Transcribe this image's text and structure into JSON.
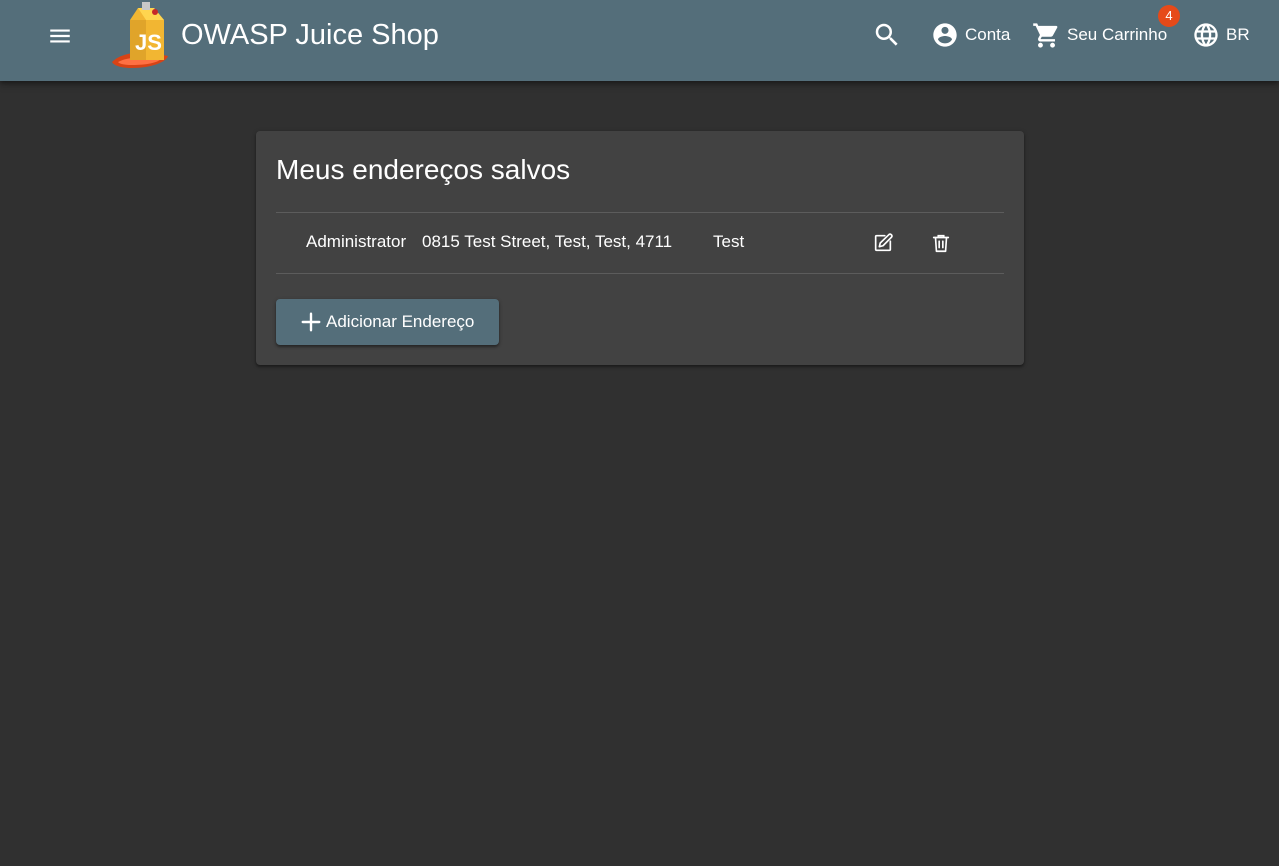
{
  "header": {
    "menu_icon": "menu-icon",
    "logo_icon": "juice-shop-logo",
    "title": "OWASP Juice Shop",
    "search_icon": "search-icon",
    "account_icon": "account-circle-icon",
    "account_label": "Conta",
    "cart_icon": "shopping-cart-icon",
    "cart_label": "Seu Carrinho",
    "cart_count": "4",
    "language_icon": "globe-icon",
    "language_label": "BR",
    "colors": {
      "toolbar": "#546e7a",
      "badge": "#e64a19"
    }
  },
  "addresses": {
    "title": "Meus endereços salvos",
    "rows": [
      {
        "name": "Administrator",
        "address": "0815 Test Street, Test, Test, 4711",
        "country": "Test",
        "edit_icon": "edit-icon",
        "delete_icon": "trash-icon"
      }
    ],
    "add_button": {
      "icon": "plus-icon",
      "label": "Adicionar Endereço"
    },
    "colors": {
      "page_background": "#303030",
      "card_background": "#424242",
      "button": "#546e7a"
    }
  }
}
